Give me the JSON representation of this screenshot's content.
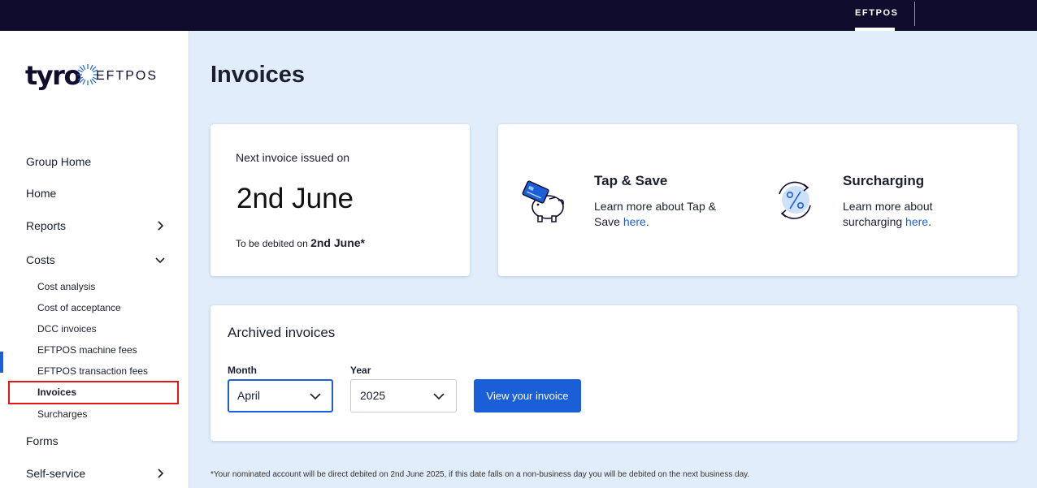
{
  "topbar": {
    "tab_label": "EFTPOS"
  },
  "brand": {
    "logo_word": "tyro",
    "logo_sub": "EFTPOS"
  },
  "nav": {
    "group_home": "Group Home",
    "home": "Home",
    "reports": "Reports",
    "costs": "Costs",
    "costs_items": [
      "Cost analysis",
      "Cost of acceptance",
      "DCC invoices",
      "EFTPOS machine fees",
      "EFTPOS transaction fees",
      "Invoices",
      "Surcharges"
    ],
    "forms": "Forms",
    "self_service": "Self-service"
  },
  "page": {
    "title": "Invoices"
  },
  "next_invoice": {
    "label": "Next invoice issued on",
    "date": "2nd June",
    "debit_prefix": "To be debited on ",
    "debit_date": "2nd June*"
  },
  "promos": {
    "tap_save": {
      "title": "Tap & Save",
      "text": "Learn more about Tap & Save ",
      "link": "here",
      "suffix": "."
    },
    "surcharging": {
      "title": "Surcharging",
      "text": "Learn more about surcharging ",
      "link": "here",
      "suffix": "."
    }
  },
  "archived": {
    "title": "Archived invoices",
    "month_label": "Month",
    "month_value": "April",
    "year_label": "Year",
    "year_value": "2025",
    "button": "View your invoice"
  },
  "footnote": "*Your nominated account will be direct debited on 2nd June 2025, if this date falls on a non-business day you will be debited on the next business day.",
  "colors": {
    "accent": "#1a5fd8",
    "topbar": "#0f0c2e",
    "background": "#e1edfb",
    "highlight": "#e0161b"
  }
}
